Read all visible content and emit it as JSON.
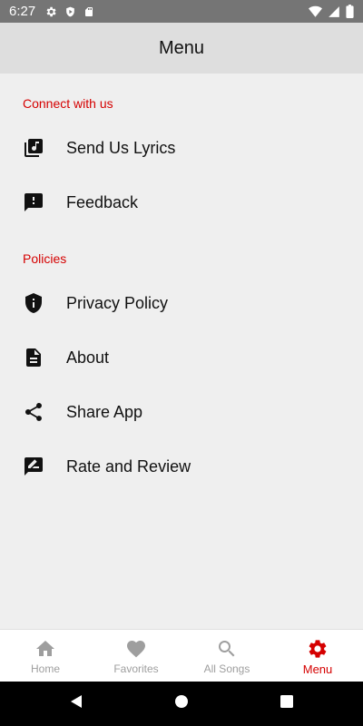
{
  "status_bar": {
    "time": "6:27"
  },
  "header": {
    "title": "Menu"
  },
  "sections": [
    {
      "title": "Connect with us",
      "items": [
        {
          "label": "Send Us Lyrics",
          "icon": "music-library-icon"
        },
        {
          "label": "Feedback",
          "icon": "feedback-icon"
        }
      ]
    },
    {
      "title": "Policies",
      "items": [
        {
          "label": "Privacy Policy",
          "icon": "shield-info-icon"
        },
        {
          "label": "About",
          "icon": "document-icon"
        },
        {
          "label": "Share App",
          "icon": "share-icon"
        },
        {
          "label": "Rate and Review",
          "icon": "rate-review-icon"
        }
      ]
    }
  ],
  "bottom_nav": {
    "items": [
      {
        "label": "Home",
        "icon": "home-icon",
        "active": false
      },
      {
        "label": "Favorites",
        "icon": "heart-icon",
        "active": false
      },
      {
        "label": "All Songs",
        "icon": "search-icon",
        "active": false
      },
      {
        "label": "Menu",
        "icon": "gear-icon",
        "active": true
      }
    ]
  },
  "colors": {
    "accent": "#d50000",
    "inactive": "#9e9e9e",
    "background": "#efefef",
    "header": "#dedede",
    "status_bar": "#757575"
  }
}
